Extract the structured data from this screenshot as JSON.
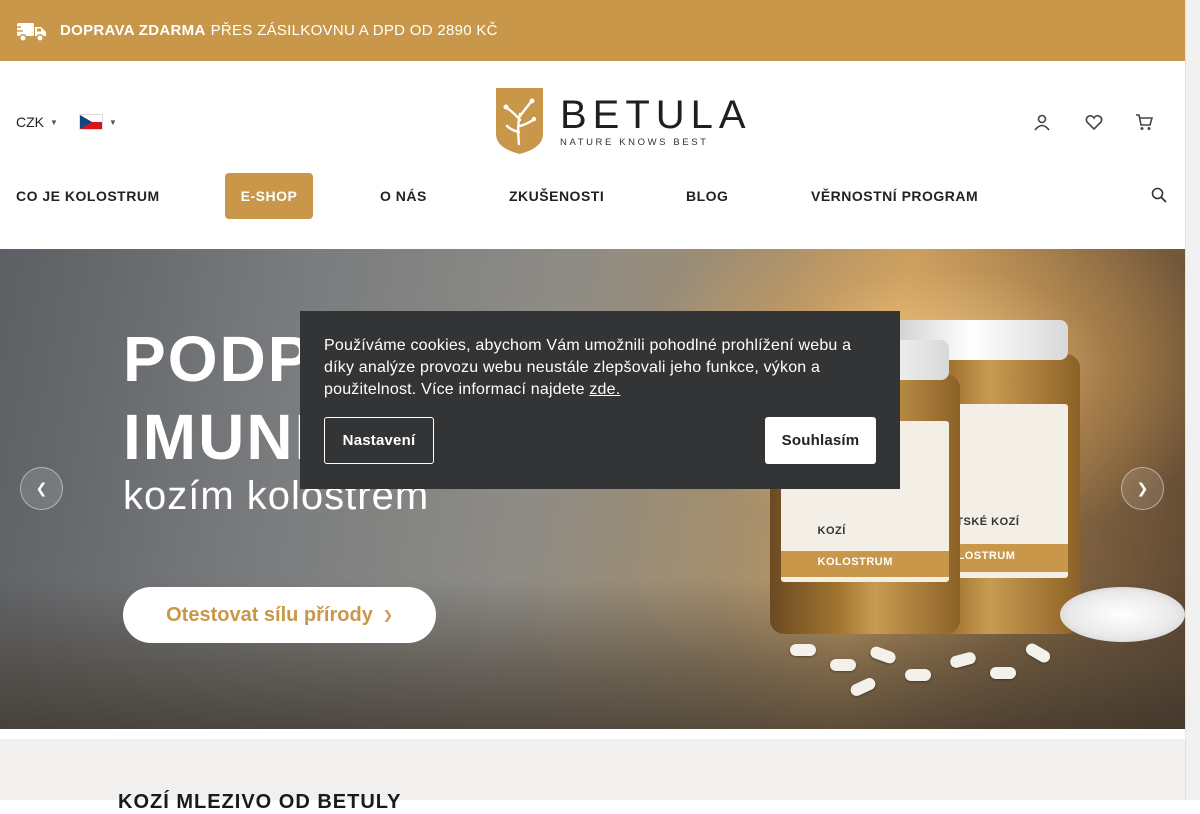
{
  "topbar": {
    "shipping_strong": "DOPRAVA ZDARMA",
    "shipping_rest": "PŘES ZÁSILKOVNU A DPD OD 2890 KČ",
    "icon": "truck-icon",
    "bg_color": "#c9974a"
  },
  "header": {
    "currency": "CZK",
    "language_flag": "czech-flag-icon",
    "logo": {
      "name": "BETULA",
      "tagline": "NATURE KNOWS BEST"
    },
    "icons": [
      "user-icon",
      "heart-icon",
      "cart-icon"
    ]
  },
  "nav": {
    "items": [
      {
        "label": "CO JE KOLOSTRUM",
        "active": false
      },
      {
        "label": "E-SHOP",
        "active": true
      },
      {
        "label": "O NÁS",
        "active": false
      },
      {
        "label": "ZKUŠENOSTI",
        "active": false
      },
      {
        "label": "BLOG",
        "active": false
      },
      {
        "label": "VĚRNOSTNÍ PROGRAM",
        "active": false
      }
    ],
    "search_icon": "search-icon"
  },
  "hero": {
    "heading_line1": "PODP",
    "heading_line2": "IMUNI",
    "subheading": "kozím kolostrem",
    "cta_label": "Otestovat sílu přírody",
    "jar_text_left": "KOZÍ",
    "jar_text_left2": "KOLOSTRUM",
    "jar_text_right": "DĚTSKÉ KOZÍ",
    "jar_text_right2": "KOLOSTRUM"
  },
  "cookie": {
    "text": "Používáme cookies, abychom Vám umožnili pohodlné prohlížení webu a díky analýze provozu webu neustále zlepšovali jeho funkce, výkon a použitelnost. Více informací najdete",
    "link": "zde.",
    "settings_label": "Nastavení",
    "agree_label": "Souhlasím"
  },
  "section": {
    "title": "KOZÍ MLEZIVO OD BETULY"
  }
}
